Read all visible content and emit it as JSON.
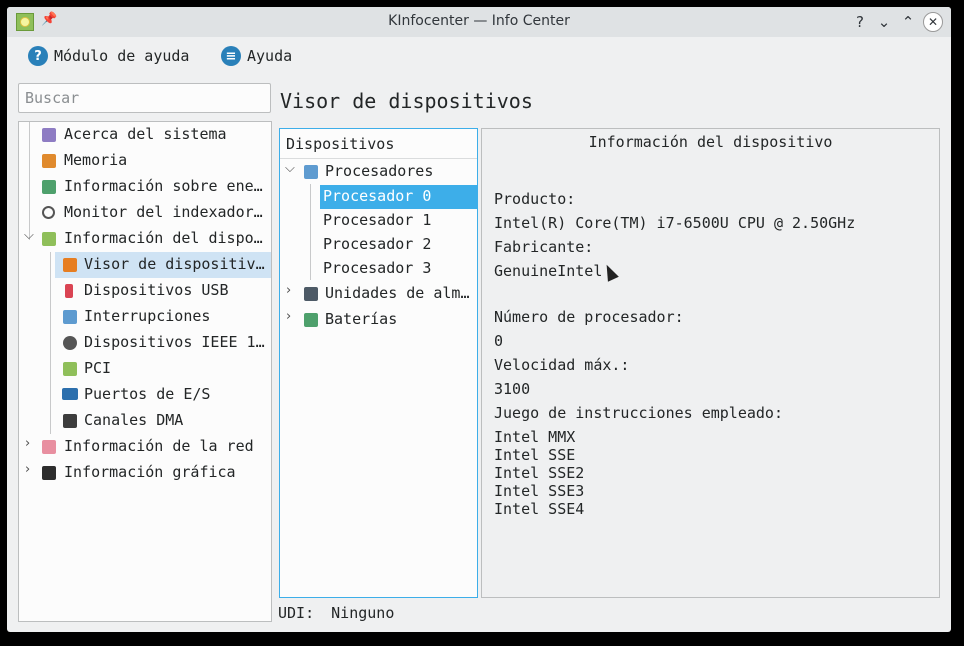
{
  "window": {
    "title": "KInfocenter — Info Center",
    "pin_glyph": "📌",
    "help_glyph": "?",
    "minimize_glyph": "⌄",
    "maximize_glyph": "⌃",
    "close_glyph": "✕"
  },
  "toolbar": {
    "help_module_label": "Módulo de ayuda",
    "help_module_glyph": "?",
    "help_label": "Ayuda",
    "help_glyph": "≡"
  },
  "search": {
    "placeholder": "Buscar"
  },
  "sidebar": {
    "items": [
      {
        "label": "Acerca del sistema",
        "icon": "about-icon",
        "color": "#8e7cc3"
      },
      {
        "label": "Memoria",
        "icon": "memory-icon",
        "color": "#e08a2d"
      },
      {
        "label": "Información sobre ene…",
        "icon": "energy-icon",
        "color": "#4ea06c"
      },
      {
        "label": "Monitor del indexador…",
        "icon": "magnifier-icon",
        "color": "#555555"
      },
      {
        "label": "Información del dispo…",
        "icon": "device-info-icon",
        "color": "#8fbf5a",
        "expanded": "⌵"
      },
      {
        "label": "Visor de dispositiv…",
        "icon": "wrench-icon",
        "color": "#e67e22"
      },
      {
        "label": "Dispositivos USB",
        "icon": "usb-icon",
        "color": "#da4453"
      },
      {
        "label": "Interrupciones",
        "icon": "chip-icon",
        "color": "#5e9bd0"
      },
      {
        "label": "Dispositivos IEEE 1…",
        "icon": "webcam-icon",
        "color": "#555555"
      },
      {
        "label": "PCI",
        "icon": "pci-icon",
        "color": "#8fbf5a"
      },
      {
        "label": "Puertos de E/S",
        "icon": "monitor-icon",
        "color": "#2c6fad"
      },
      {
        "label": "Canales DMA",
        "icon": "dma-icon",
        "color": "#3d3d3d"
      },
      {
        "label": "Información de la red",
        "icon": "network-icon",
        "color": "#e88fa0",
        "collapsed": "›"
      },
      {
        "label": "Información gráfica",
        "icon": "graphics-icon",
        "color": "#2d2d2d",
        "collapsed": "›"
      }
    ]
  },
  "heading": "Visor de dispositivos",
  "devices": {
    "header": "Dispositivos",
    "processors_label": "Procesadores",
    "processors_expanded": "⌵",
    "processor_items": [
      "Procesador 0",
      "Procesador 1",
      "Procesador 2",
      "Procesador 3"
    ],
    "storage_label": "Unidades de alm…",
    "storage_collapsed": "›",
    "batteries_label": "Baterías",
    "batteries_collapsed": "›"
  },
  "info": {
    "title": "Información del dispositivo",
    "product_label": "Producto:",
    "product_value": "Intel(R) Core(TM) i7-6500U CPU @ 2.50GHz",
    "vendor_label": "Fabricante:",
    "vendor_value": "GenuineIntel",
    "processor_number_label": "Número de procesador:",
    "processor_number_value": "0",
    "max_speed_label": "Velocidad máx.:",
    "max_speed_value": "3100",
    "instruction_set_label": "Juego de instrucciones empleado:",
    "instruction_sets": [
      "Intel MMX",
      "Intel SSE",
      "Intel SSE2",
      "Intel SSE3",
      "Intel SSE4"
    ]
  },
  "udi": {
    "label": "UDI:",
    "value": "Ninguno"
  }
}
